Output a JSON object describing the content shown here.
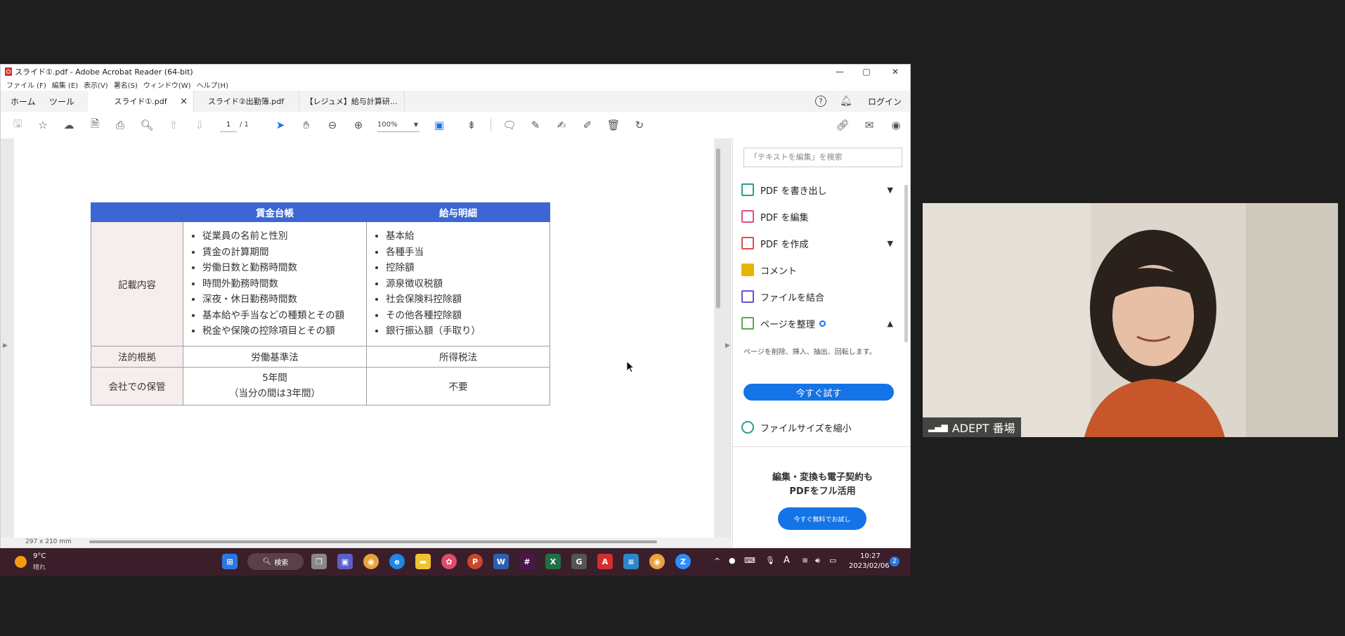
{
  "window": {
    "title": "スライド①.pdf - Adobe Acrobat Reader (64-bit)",
    "minimize": "—",
    "maximize": "▢",
    "close": "✕"
  },
  "menu": [
    "ファイル (F)",
    "編集 (E)",
    "表示(V)",
    "署名(S)",
    "ウィンドウ(W)",
    "ヘルプ(H)"
  ],
  "tabs": {
    "home": "ホーム",
    "tools": "ツール",
    "docs": [
      "スライド①.pdf",
      "スライド②出勤簿.pdf",
      "【レジュメ】給与計算研..."
    ],
    "doc_close": "×",
    "help_icon": "?",
    "login": "ログイン"
  },
  "toolbar": {
    "page_current": "1",
    "page_total": "/ 1",
    "zoom": "100%"
  },
  "table": {
    "headers": [
      "",
      "賃金台帳",
      "給与明細"
    ],
    "rows": [
      {
        "label": "記載内容",
        "col1": [
          "従業員の名前と性別",
          "賃金の計算期間",
          "労働日数と勤務時間数",
          "時間外勤務時間数",
          "深夜・休日勤務時間数",
          "基本給や手当などの種類とその額",
          "税金や保険の控除項目とその額"
        ],
        "col2": [
          "基本給",
          "各種手当",
          "控除額",
          "源泉徴収税額",
          "社会保険料控除額",
          "その他各種控除額",
          "銀行振込額（手取り）"
        ]
      },
      {
        "label": "法的根拠",
        "col1": "労働基準法",
        "col2": "所得税法"
      },
      {
        "label": "会社での保管",
        "col1_line1": "5年間",
        "col1_line2": "（当分の間は3年間）",
        "col2": "不要"
      }
    ]
  },
  "status": {
    "page_size": "297 x 210 mm"
  },
  "rightpane": {
    "search_placeholder": "「テキストを編集」を検索",
    "tools": [
      {
        "label": "PDF を書き出し",
        "icon": "export-pdf-icon",
        "color": "#2a9d8f"
      },
      {
        "label": "PDF を編集",
        "icon": "edit-pdf-icon",
        "color": "#e0527a"
      },
      {
        "label": "PDF を作成",
        "icon": "create-pdf-icon",
        "color": "#e04b4b"
      },
      {
        "label": "コメント",
        "icon": "comment-icon",
        "color": "#e8b400"
      },
      {
        "label": "ファイルを結合",
        "icon": "combine-files-icon",
        "color": "#6b4fd6"
      },
      {
        "label": "ページを整理",
        "icon": "organize-pages-icon",
        "color": "#5ba84a"
      }
    ],
    "organize_desc": "ページを削除、挿入、抽出、回転します。",
    "try_button": "今すぐ試す",
    "compress": "ファイルサイズを縮小",
    "promo_line1": "編集・変換も電子契約も",
    "promo_line2": "PDFをフル活用",
    "promo_button": "今すぐ無料でお試し"
  },
  "taskbar": {
    "temp": "9°C",
    "weather": "晴れ",
    "search": "検索",
    "ime": "A",
    "time": "10:27",
    "date": "2023/02/06",
    "notifications": "2"
  },
  "video": {
    "name": "ADEPT 番場"
  },
  "colors": {
    "header_blue": "#3b66d4",
    "accent_blue": "#1473e6",
    "taskbar": "#3a1f2a"
  }
}
